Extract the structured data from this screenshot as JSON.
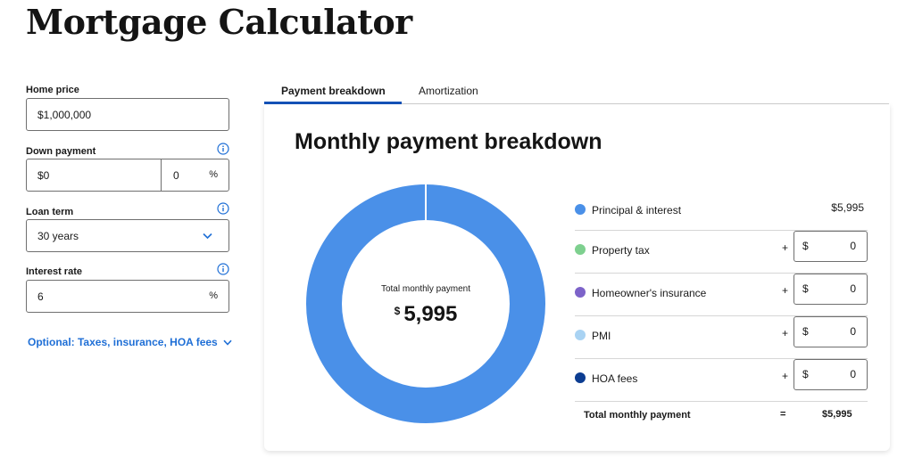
{
  "title": "Mortgage Calculator",
  "form": {
    "home_price": {
      "label": "Home price",
      "value": "$1,000,000"
    },
    "down_payment": {
      "label": "Down payment",
      "value": "$0",
      "percent": "0",
      "percent_suffix": "%"
    },
    "loan_term": {
      "label": "Loan term",
      "value": "30 years"
    },
    "interest_rate": {
      "label": "Interest rate",
      "value": "6",
      "suffix": "%"
    },
    "optional_link": "Optional: Taxes, insurance, HOA fees"
  },
  "tabs": [
    {
      "label": "Payment breakdown",
      "active": true
    },
    {
      "label": "Amortization",
      "active": false
    }
  ],
  "card": {
    "title": "Monthly payment breakdown",
    "donut_caption": "Total monthly payment",
    "donut_currency": "$",
    "donut_total": "5,995"
  },
  "breakdown": [
    {
      "label": "Principal & interest",
      "value": "$5,995",
      "color": "#4a90e8",
      "editable": false
    },
    {
      "label": "Property tax",
      "currency": "$",
      "value": "0",
      "color": "#7ed08f",
      "editable": true
    },
    {
      "label": "Homeowner's insurance",
      "currency": "$",
      "value": "0",
      "color": "#7d63c9",
      "editable": true
    },
    {
      "label": "PMI",
      "currency": "$",
      "value": "0",
      "color": "#a9d3f3",
      "editable": true
    },
    {
      "label": "HOA fees",
      "currency": "$",
      "value": "0",
      "color": "#0c3d91",
      "editable": true
    }
  ],
  "plus_sign": "+",
  "total": {
    "label": "Total monthly payment",
    "equals": "=",
    "value": "$5,995"
  },
  "colors": {
    "accent": "#1f6fd6",
    "tab_underline": "#1452b8",
    "donut": "#4a90e8"
  },
  "donut_share": 1.0
}
